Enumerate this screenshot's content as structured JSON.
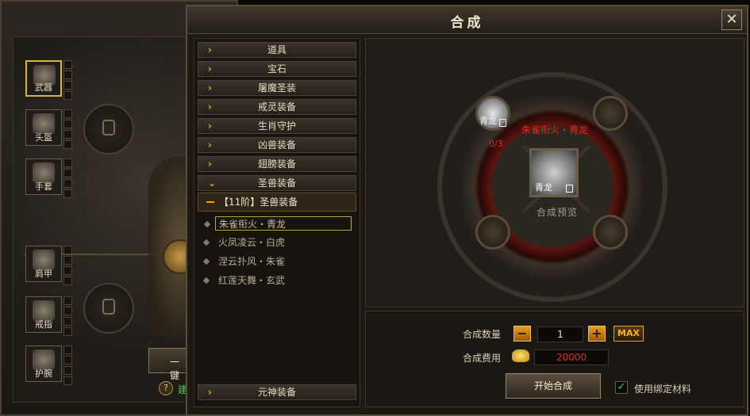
{
  "background_panel": {
    "slots": [
      {
        "label": "武器",
        "selected": true
      },
      {
        "label": "头盔",
        "selected": false
      },
      {
        "label": "手套",
        "selected": false
      },
      {
        "label": "肩甲",
        "selected": false
      },
      {
        "label": "戒指",
        "selected": false
      },
      {
        "label": "护腕",
        "selected": false
      }
    ],
    "partial_button_label": "一键",
    "help_glyph": "?",
    "green_partial_text": "建"
  },
  "window": {
    "title": "合成",
    "close_glyph": "✕",
    "categories": [
      {
        "label": "道具",
        "expanded": false
      },
      {
        "label": "宝石",
        "expanded": false
      },
      {
        "label": "屠魔圣装",
        "expanded": false
      },
      {
        "label": "戒灵装备",
        "expanded": false
      },
      {
        "label": "生肖守护",
        "expanded": false
      },
      {
        "label": "凶兽装备",
        "expanded": false
      },
      {
        "label": "翅膀装备",
        "expanded": false
      },
      {
        "label": "圣兽装备",
        "expanded": true
      }
    ],
    "tier_header": "【11阶】圣兽装备",
    "items": [
      {
        "label": "朱雀衔火・青龙",
        "selected": true
      },
      {
        "label": "火凤凌云・白虎",
        "selected": false
      },
      {
        "label": "涅云扑风・朱雀",
        "selected": false
      },
      {
        "label": "红莲天舞・玄武",
        "selected": false
      }
    ],
    "bottom_category": "元神装备",
    "synthesis": {
      "result_name": "朱雀衔火・青龙",
      "material_name": "青龙",
      "material_ratio": "0/3",
      "preview_label": "合成预览",
      "preview_item_name": "青龙"
    },
    "quantity_label": "合成数量",
    "quantity_value": "1",
    "minus_glyph": "−",
    "plus_glyph": "+",
    "max_label": "MAX",
    "cost_label": "合成费用",
    "cost_value": "20000",
    "start_button": "开始合成",
    "checkbox_checked": true,
    "checkbox_glyph": "✓",
    "checkbox_label": "使用绑定材料",
    "colors": {
      "accent_orange": "#f0a020",
      "cost_red": "#e02a1a",
      "check_green": "#3cd63c"
    }
  }
}
